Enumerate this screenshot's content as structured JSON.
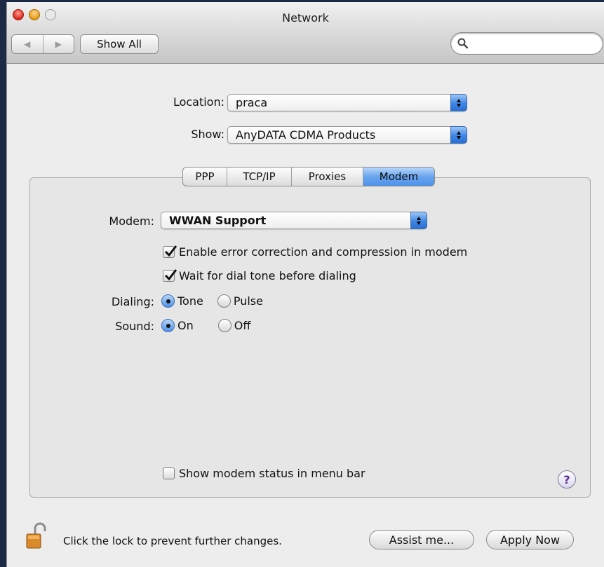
{
  "window": {
    "title": "Network"
  },
  "toolbar": {
    "back_label": "◀",
    "forward_label": "▶",
    "show_all_label": "Show All",
    "search_placeholder": ""
  },
  "location": {
    "label": "Location:",
    "value": "praca"
  },
  "show": {
    "label": "Show:",
    "value": "AnyDATA CDMA Products"
  },
  "tabs": [
    {
      "label": "PPP",
      "active": false
    },
    {
      "label": "TCP/IP",
      "active": false
    },
    {
      "label": "Proxies",
      "active": false
    },
    {
      "label": "Modem",
      "active": true
    }
  ],
  "modem": {
    "label": "Modem:",
    "value": "WWAN Support",
    "error_correction_label": "Enable error correction and compression in modem",
    "error_correction_checked": true,
    "wait_dial_tone_label": "Wait for dial tone before dialing",
    "wait_dial_tone_checked": true,
    "dialing_label": "Dialing:",
    "dialing_options": [
      "Tone",
      "Pulse"
    ],
    "dialing_selected": "Tone",
    "sound_label": "Sound:",
    "sound_options": [
      "On",
      "Off"
    ],
    "sound_selected": "On",
    "status_menu_label": "Show modem status in menu bar",
    "status_menu_checked": false
  },
  "help_label": "?",
  "footer": {
    "lock_text": "Click the lock to prevent further changes.",
    "assist_label": "Assist me...",
    "apply_label": "Apply Now"
  },
  "colors": {
    "accent": "#4e92ea",
    "window_bg": "#ededed"
  }
}
